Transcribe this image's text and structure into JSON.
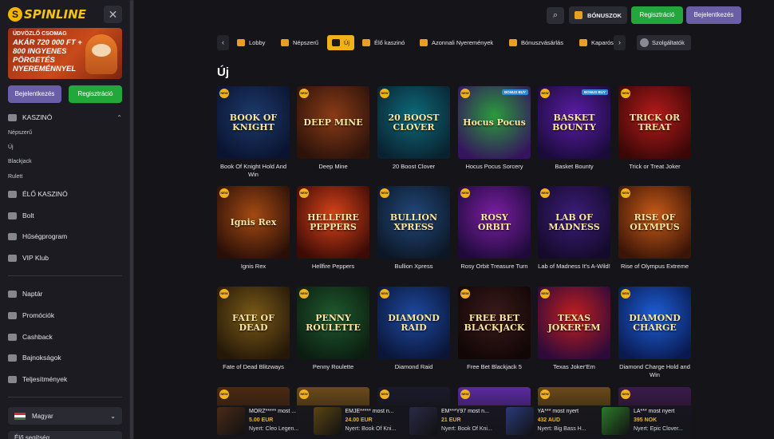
{
  "sidebar": {
    "logo": "SPINLINE",
    "banner": {
      "kicker": "ÜDVÖZLŐ CSOMAG",
      "headline": "AKÁR 720 000 FT + 800 INGYENES PÖRGETÉS NYEREMÉNNYEL"
    },
    "login_label": "Bejelentkezés",
    "register_label": "Regisztráció",
    "casino_label": "KASZINÓ",
    "casino_items": [
      "Népszerű",
      "Új",
      "Blackjack",
      "Rulett"
    ],
    "nav1": [
      "ÉLŐ KASZINÓ",
      "Bolt",
      "Hűségprogram",
      "VIP Klub"
    ],
    "nav2": [
      "Naptár",
      "Promóciók",
      "Cashback",
      "Bajnokságok",
      "Teljesítmények"
    ],
    "language": "Magyar",
    "help": "Élő segítség"
  },
  "header": {
    "bonus_label": "BÓNUSZOK",
    "register_label": "Regisztráció",
    "login_label": "Bejelentkezés"
  },
  "categories": [
    "Lobby",
    "Népszerű",
    "Új",
    "Élő kaszinó",
    "Azonnali Nyeremények",
    "Bónuszvásárlás",
    "Kaparós"
  ],
  "active_category": "Új",
  "providers_label": "Szolgáltatók",
  "section_title": "Új",
  "games": [
    {
      "name": "Book Of Knight Hold And Win",
      "art": "BOOK OF KNIGHT",
      "bonus": ""
    },
    {
      "name": "Deep Mine",
      "art": "DEEP MINE",
      "bonus": ""
    },
    {
      "name": "20 Boost Clover",
      "art": "20 BOOST CLOVER",
      "bonus": ""
    },
    {
      "name": "Hocus Pocus Sorcery",
      "art": "Hocus Pocus",
      "bonus": "BONUS BUY"
    },
    {
      "name": "Basket Bounty",
      "art": "BASKET BOUNTY",
      "bonus": "BONUS BUY"
    },
    {
      "name": "Trick or Treat Joker",
      "art": "TRICK OR TREAT",
      "bonus": ""
    },
    {
      "name": "Ignis Rex",
      "art": "Ignis Rex",
      "bonus": ""
    },
    {
      "name": "Hellfire Peppers",
      "art": "HELLFIRE PEPPERS",
      "bonus": ""
    },
    {
      "name": "Bullion Xpress",
      "art": "BULLION XPRESS",
      "bonus": ""
    },
    {
      "name": "Rosy Orbit Treasure Turn",
      "art": "ROSY ORBIT",
      "bonus": ""
    },
    {
      "name": "Lab of Madness It's A-Wild!",
      "art": "LAB OF MADNESS",
      "bonus": ""
    },
    {
      "name": "Rise of Olympus Extreme",
      "art": "RISE OF OLYMPUS",
      "bonus": ""
    },
    {
      "name": "Fate of Dead Blitzways",
      "art": "FATE OF DEAD",
      "bonus": ""
    },
    {
      "name": "Penny Roulette",
      "art": "PENNY ROULETTE",
      "bonus": ""
    },
    {
      "name": "Diamond Raid",
      "art": "DIAMOND RAID",
      "bonus": ""
    },
    {
      "name": "Free Bet Blackjack 5",
      "art": "FREE BET BLACKJACK",
      "bonus": ""
    },
    {
      "name": "Texas Joker'Em",
      "art": "TEXAS JOKER'EM",
      "bonus": ""
    },
    {
      "name": "Diamond Charge Hold and Win",
      "art": "DIAMOND CHARGE",
      "bonus": ""
    }
  ],
  "wins": [
    {
      "user": "MORZ***** most ...",
      "amount": "5.00 EUR",
      "game": "Nyert: Cleo Legen..."
    },
    {
      "user": "EMJE***** most n...",
      "amount": "24.00 EUR",
      "game": "Nyert: Book Of Kni..."
    },
    {
      "user": "EM***Y97 most n...",
      "amount": "21 EUR",
      "game": "Nyert: Book Of Kni..."
    },
    {
      "user": "YA*** most nyert",
      "amount": "432 AUD",
      "game": "Nyert: Big Bass H..."
    },
    {
      "user": "LA*** most nyert",
      "amount": "395 NOK",
      "game": "Nyert: Epic Clover..."
    }
  ],
  "colors": {
    "accent": "#f0b218",
    "green": "#23a63b",
    "purple": "#6a5fa6",
    "bg": "#151519"
  }
}
